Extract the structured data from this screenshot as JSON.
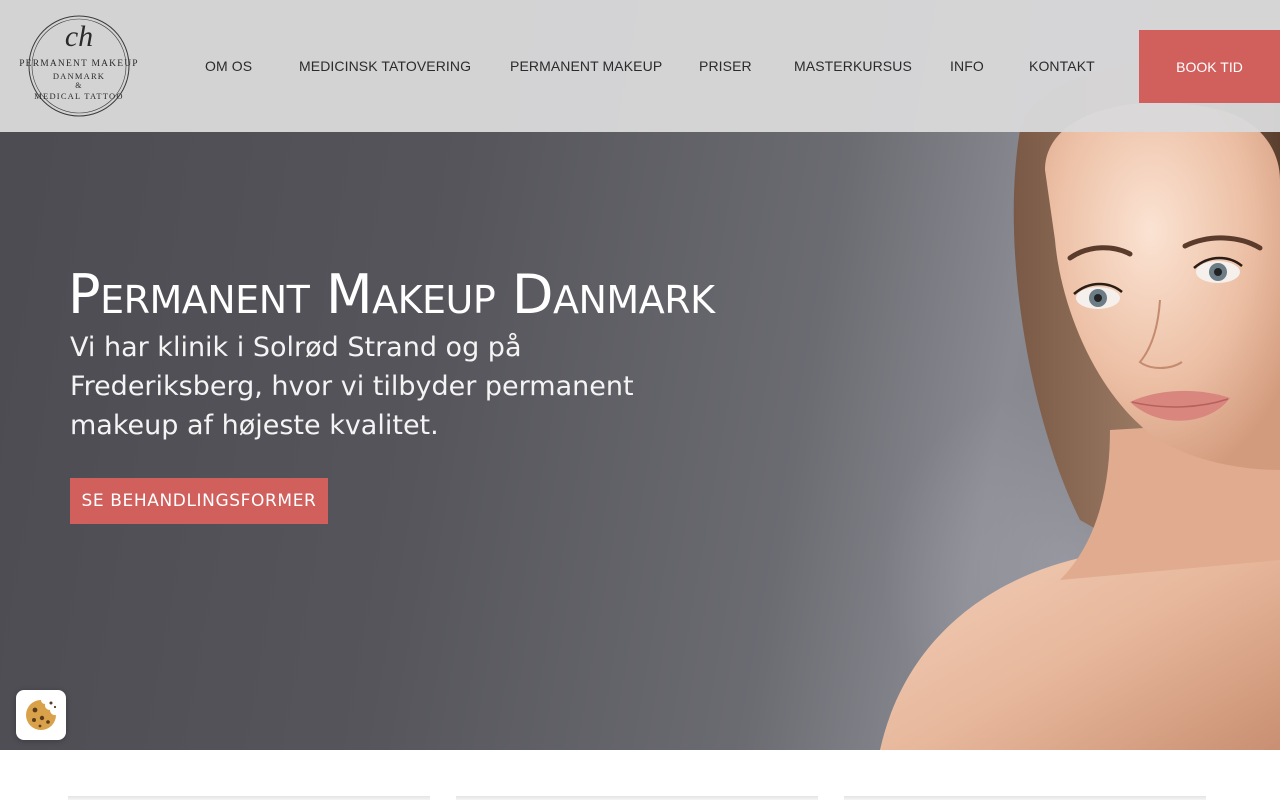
{
  "logo": {
    "monogram": "ch",
    "line1": "PERMANENT MAKEUP",
    "line2": "DANMARK",
    "ampersand": "&",
    "line3": "MEDICAL TATTOO"
  },
  "nav": {
    "items": [
      {
        "label": "OM OS"
      },
      {
        "label": "MEDICINSK TATOVERING"
      },
      {
        "label": "PERMANENT MAKEUP"
      },
      {
        "label": "PRISER"
      },
      {
        "label": "MASTERKURSUS"
      },
      {
        "label": "INFO"
      },
      {
        "label": "KONTAKT"
      }
    ],
    "book_label": "BOOK TID"
  },
  "hero": {
    "title": "Permanent Makeup Danmark",
    "subtitle": "Vi har klinik i Solrød Strand og på Frederiksberg, hvor vi tilbyder permanent makeup af højeste kvalitet.",
    "cta_label": "SE BEHANDLINGSFORMER"
  },
  "cookie": {
    "icon": "cookie-icon"
  },
  "colors": {
    "accent": "#d1605d",
    "header_bg": "#d8d8da",
    "hero_bg": "#55555b"
  }
}
